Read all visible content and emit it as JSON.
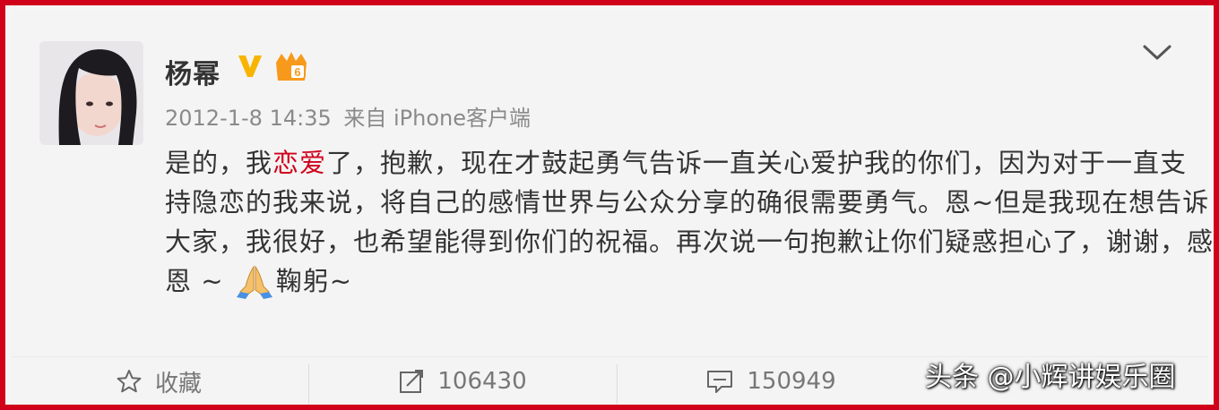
{
  "post": {
    "username": "杨幂",
    "timestamp": "2012-1-8 14:35",
    "source": "来自 iPhone客户端",
    "content_parts": {
      "p1": "是的，我",
      "highlight": "恋爱",
      "p2": "了，抱歉，现在才鼓起勇气告诉一直关心爱护我的你们，因为对于一直支持隐恋的我来说，将自己的感情世界与公众分享的确很需要勇气。恩~但是我现在想告诉大家，我很好，也希望能得到你们的祝福。再次说一句抱歉让你们疑惑担心了，谢谢，感恩 ~ ",
      "p3": "鞠躬~"
    },
    "icons": {
      "verified": "verified-v-icon",
      "vip": "vip-crown-icon",
      "menu": "chevron-down-icon",
      "emoji": "praying-hands-icon"
    }
  },
  "actions": {
    "favorite_label": "收藏",
    "repost_count": "106430",
    "comment_count": "150949"
  },
  "watermark": "头条 @小辉讲娱乐圈",
  "colors": {
    "frame": "#d0021b",
    "highlight": "#d0021b",
    "verified": "#f7b500"
  }
}
